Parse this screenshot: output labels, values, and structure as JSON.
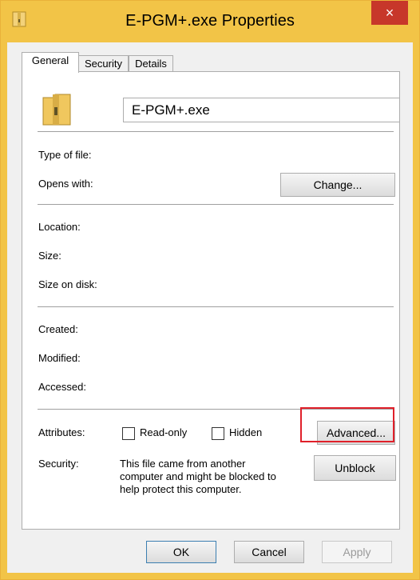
{
  "window": {
    "title": "E-PGM+.exe Properties",
    "close_glyph": "×",
    "accent": "#f2c447",
    "close_color": "#c7372a"
  },
  "tabs": [
    {
      "label": "General"
    },
    {
      "label": "Security"
    },
    {
      "label": "Details"
    }
  ],
  "general": {
    "file_name": "E-PGM+.exe",
    "type_label": "Type of file:",
    "opens_label": "Opens with:",
    "change_button": "Change...",
    "location_label": "Location:",
    "size_label": "Size:",
    "size_on_disk_label": "Size on disk:",
    "created_label": "Created:",
    "modified_label": "Modified:",
    "accessed_label": "Accessed:",
    "attributes_label": "Attributes:",
    "readonly_label": "Read-only",
    "hidden_label": "Hidden",
    "advanced_button": "Advanced...",
    "security_label": "Security:",
    "security_text_1": "This file came from another",
    "security_text_2": "computer and might be blocked to",
    "security_text_3": "help protect this computer.",
    "unblock_button": "Unblock",
    "highlight_color": "#e0202a"
  },
  "footer": {
    "ok": "OK",
    "cancel": "Cancel",
    "apply": "Apply"
  }
}
